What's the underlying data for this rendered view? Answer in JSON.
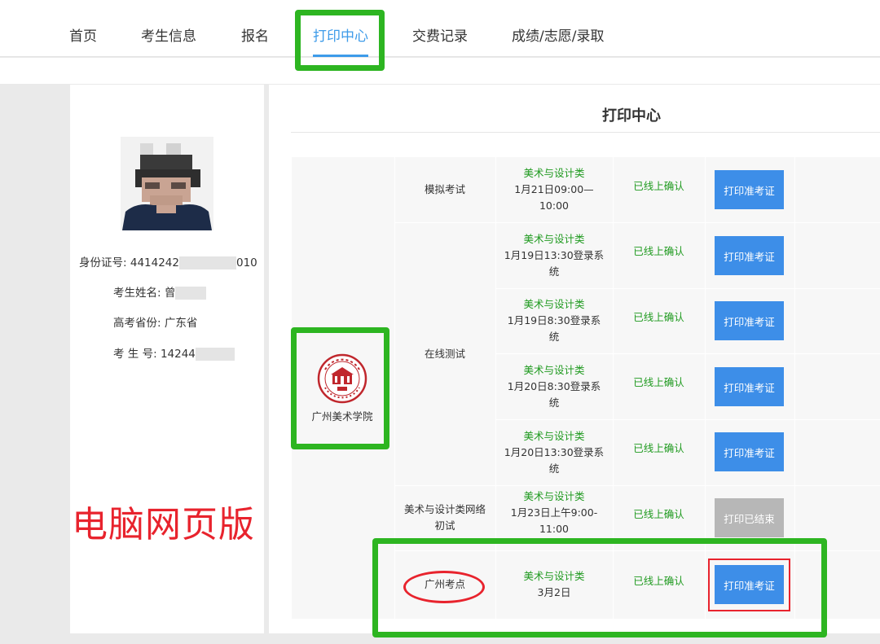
{
  "nav": {
    "items": [
      "首页",
      "考生信息",
      "报名",
      "打印中心",
      "交费记录",
      "成绩/志愿/录取"
    ],
    "active_index": 3
  },
  "profile": {
    "id_label": "身份证号:",
    "id_visible_start": "4414242",
    "id_visible_end": "010",
    "name_label": "考生姓名:",
    "name_visible": "曾",
    "province_label": "高考省份:",
    "province_value": "广东省",
    "exam_no_label": "考 生 号:",
    "exam_no_visible": "14244"
  },
  "watermark": "电脑网页版",
  "main": {
    "title": "打印中心",
    "school": {
      "name": "广州美术学院",
      "logo_icon": "gafa-seal-icon"
    },
    "groups": [
      "模拟考试",
      "在线测试",
      "美术与设计类网络初试",
      "广州考点"
    ],
    "rows": [
      {
        "subject": "美术与设计类",
        "time": "1月21日09:00—10:00",
        "status": "已线上确认",
        "button": "打印准考证",
        "ended": false
      },
      {
        "subject": "美术与设计类",
        "time": "1月19日13:30登录系统",
        "status": "已线上确认",
        "button": "打印准考证",
        "ended": false
      },
      {
        "subject": "美术与设计类",
        "time": "1月19日8:30登录系统",
        "status": "已线上确认",
        "button": "打印准考证",
        "ended": false
      },
      {
        "subject": "美术与设计类",
        "time": "1月20日8:30登录系统",
        "status": "已线上确认",
        "button": "打印准考证",
        "ended": false
      },
      {
        "subject": "美术与设计类",
        "time": "1月20日13:30登录系统",
        "status": "已线上确认",
        "button": "打印准考证",
        "ended": false
      },
      {
        "subject": "美术与设计类",
        "time": "1月23日上午9:00-11:00",
        "status": "已线上确认",
        "button": "打印已结束",
        "ended": true
      },
      {
        "subject": "美术与设计类",
        "time": "3月2日",
        "status": "已线上确认",
        "button": "打印准考证",
        "ended": false
      }
    ]
  },
  "colors": {
    "accent": "#3d9be9",
    "button": "#3d8ee8",
    "button_disabled": "#b7b7b7",
    "status_green": "#1f9a1f",
    "annotation_green": "#2db521",
    "annotation_red": "#e8232d"
  }
}
